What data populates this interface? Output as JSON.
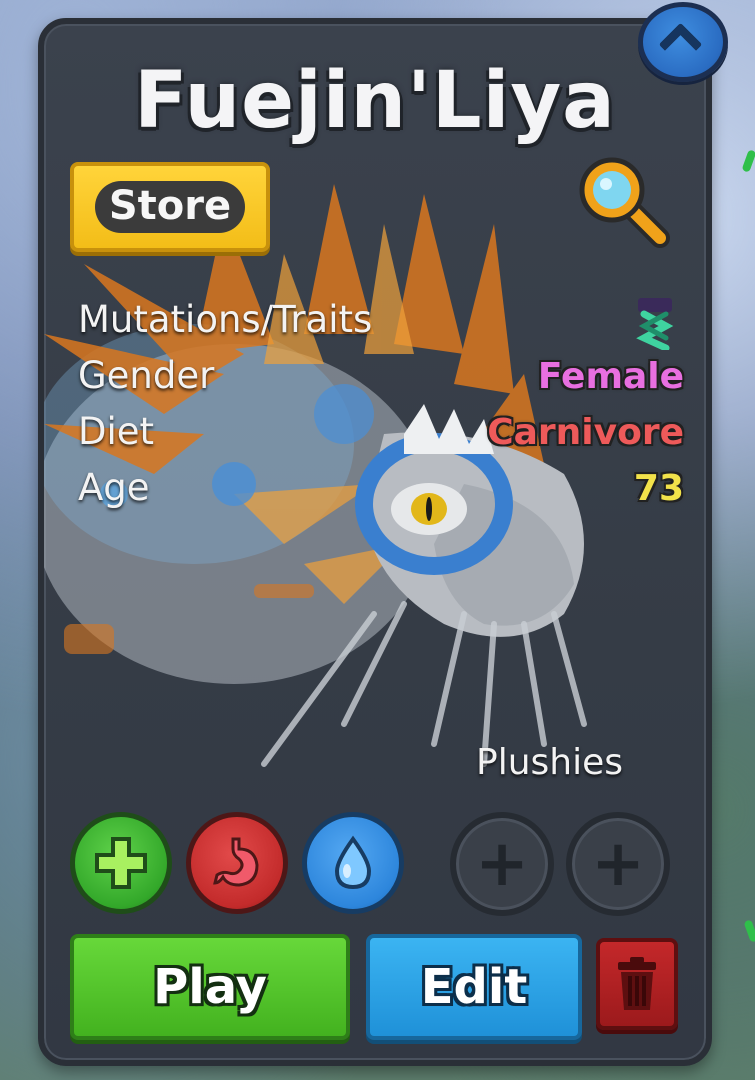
{
  "card": {
    "title": "Fuejin'Liya"
  },
  "header": {
    "store_label": "Store"
  },
  "info": {
    "rows": [
      {
        "label": "Mutations/Traits",
        "value": "",
        "color": "#3fd3a0"
      },
      {
        "label": "Gender",
        "value": "Female",
        "color": "#e86fe0"
      },
      {
        "label": "Diet",
        "value": "Carnivore",
        "color": "#ee5a5a"
      },
      {
        "label": "Age",
        "value": "73",
        "color": "#f2e24a"
      }
    ]
  },
  "actions": {
    "heal_icon": "plus-icon",
    "food_icon": "stomach-icon",
    "water_icon": "water-drop-icon"
  },
  "plushies": {
    "label": "Plushies",
    "slots": [
      "+",
      "+"
    ]
  },
  "buttons": {
    "play_label": "Play",
    "edit_label": "Edit",
    "delete_icon": "trash-icon"
  },
  "colors": {
    "store": "#f3bd18",
    "play": "#43b21f",
    "edit": "#1f91d8",
    "delete": "#9c1a1c",
    "heal": "#33a82a",
    "food": "#c32b2b",
    "water": "#2d86dc"
  }
}
